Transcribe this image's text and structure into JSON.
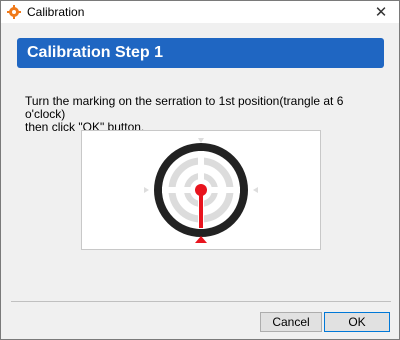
{
  "window": {
    "title": "Calibration",
    "close_glyph": "✕",
    "app_icon": "gear-icon"
  },
  "banner": {
    "title": "Calibration Step 1",
    "color": "#1f66c2"
  },
  "instruction": {
    "line1": "Turn the marking on the serration to 1st position(trangle at 6 o'clock)",
    "line2": "then click \"OK\" button."
  },
  "diagram": {
    "marker_position": "6 o'clock",
    "indicator_color": "#e8141e",
    "ring_color": "#222222"
  },
  "buttons": {
    "cancel_label": "Cancel",
    "ok_label": "OK"
  }
}
